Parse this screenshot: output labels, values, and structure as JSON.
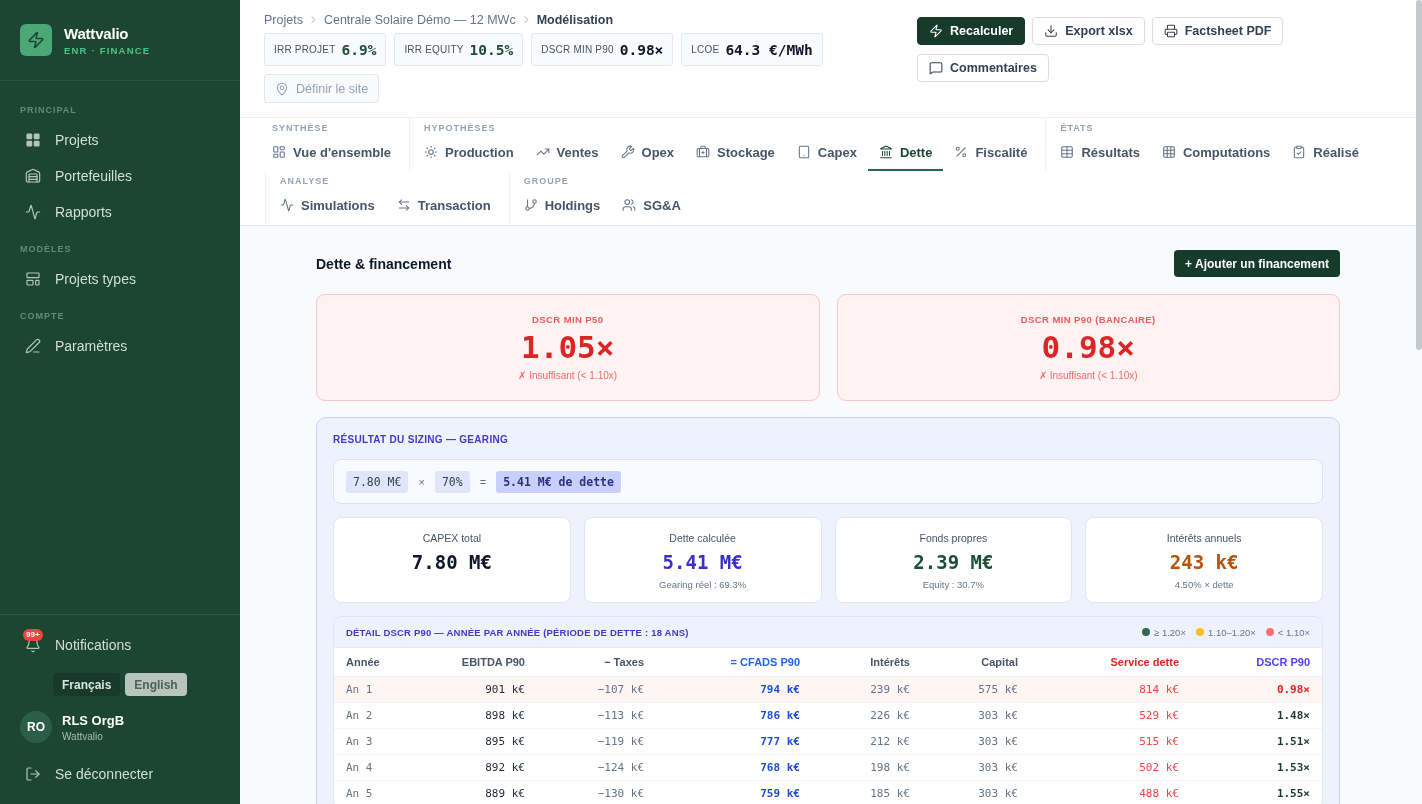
{
  "sidebar": {
    "brand": {
      "name": "Wattvalio",
      "tagline": "ENR · FINANCE"
    },
    "sections": [
      {
        "label": "PRINCIPAL",
        "items": [
          {
            "label": "Projets",
            "selected": false
          },
          {
            "label": "Portefeuilles",
            "selected": false
          },
          {
            "label": "Rapports",
            "selected": false
          }
        ]
      },
      {
        "label": "MODÈLES",
        "items": [
          {
            "label": "Projets types",
            "selected": false
          }
        ]
      },
      {
        "label": "COMPTE",
        "items": [
          {
            "label": "Paramètres",
            "selected": false
          }
        ]
      }
    ],
    "notifications": {
      "label": "Notifications",
      "badge": "99+"
    },
    "languages": [
      {
        "label": "Français",
        "selected": true
      },
      {
        "label": "English",
        "selected": false
      }
    ],
    "user": {
      "initials": "RO",
      "name": "RLS OrgB",
      "organization": "Wattvalio"
    },
    "logout": {
      "label": "Se déconnecter"
    }
  },
  "header": {
    "breadcrumb": [
      {
        "label": "Projets"
      },
      {
        "label": "Centrale Solaire Démo — 12 MWc"
      },
      {
        "label": "Modélisation"
      }
    ],
    "kpis": [
      {
        "label": "IRR PROJET",
        "value": "6.9%",
        "kind": "good"
      },
      {
        "label": "IRR EQUITY",
        "value": "10.5%",
        "kind": "good"
      },
      {
        "label": "DSCR MIN P90",
        "value": "0.98×",
        "kind": "neutral"
      },
      {
        "label": "LCOE",
        "value": "64.3 €/MWh",
        "kind": "neutral"
      }
    ],
    "site_button": {
      "label": "Définir le site",
      "disabled": true
    },
    "actions": [
      {
        "label": "Recalculer",
        "kind": "primary"
      },
      {
        "label": "Export xlsx",
        "kind": "secondary"
      },
      {
        "label": "Factsheet PDF",
        "kind": "secondary"
      },
      {
        "label": "Commentaires",
        "kind": "secondary"
      }
    ]
  },
  "nav": {
    "groups": [
      {
        "label": "SYNTHÈSE",
        "tabs": [
          {
            "label": "Vue d'ensemble",
            "selected": false
          }
        ]
      },
      {
        "label": "HYPOTHÈSES",
        "tabs": [
          {
            "label": "Production",
            "selected": false
          },
          {
            "label": "Ventes",
            "selected": false
          },
          {
            "label": "Opex",
            "selected": false
          },
          {
            "label": "Stockage",
            "selected": false
          },
          {
            "label": "Capex",
            "selected": false
          },
          {
            "label": "Dette",
            "selected": true
          },
          {
            "label": "Fiscalité",
            "selected": false
          }
        ]
      },
      {
        "label": "ÉTATS",
        "tabs": [
          {
            "label": "Résultats",
            "selected": false
          },
          {
            "label": "Computations",
            "selected": false
          },
          {
            "label": "Réalisé",
            "selected": false
          }
        ]
      },
      {
        "label": "ANALYSE",
        "tabs": [
          {
            "label": "Simulations",
            "selected": false
          },
          {
            "label": "Transaction",
            "selected": false
          }
        ]
      },
      {
        "label": "GROUPE",
        "tabs": [
          {
            "label": "Holdings",
            "selected": false
          },
          {
            "label": "SG&A",
            "selected": false
          }
        ]
      }
    ]
  },
  "content": {
    "title": "Dette & financement",
    "add_button": "+ Ajouter un financement",
    "dscr_cards": [
      {
        "label": "DSCR MIN P50",
        "value": "1.05×",
        "note": "✗ Insuffisant (< 1.10x)",
        "kind": "insufficient"
      },
      {
        "label": "DSCR MIN P90 (BANCAIRE)",
        "value": "0.98×",
        "note": "✗ Insuffisant (< 1.10x)",
        "kind": "insufficient"
      }
    ],
    "sizing": {
      "title": "RÉSULTAT DU SIZING — GEARING",
      "formula": [
        {
          "kind": "term",
          "text": "7.80 M€"
        },
        {
          "kind": "operator",
          "text": "×"
        },
        {
          "kind": "term",
          "text": "70%"
        },
        {
          "kind": "operator",
          "text": "="
        },
        {
          "kind": "result",
          "text": "5.41 M€ de dette"
        }
      ],
      "stats": [
        {
          "label": "CAPEX total",
          "value": "7.80 M€",
          "kind": "neutral"
        },
        {
          "label": "Dette calculée",
          "value": "5.41 M€",
          "note": "Gearing réel : 69.3%",
          "kind": "debt"
        },
        {
          "label": "Fonds propres",
          "value": "2.39 M€",
          "note": "Equity : 30.7%",
          "kind": "equity"
        },
        {
          "label": "Intérêts annuels",
          "value": "243 k€",
          "note": "4.50% × dette",
          "kind": "interest"
        }
      ]
    },
    "dscr_table": {
      "title": "DÉTAIL DSCR P90 — ANNÉE PAR ANNÉE (PÉRIODE DE DETTE : 18 ANS)",
      "legend": [
        {
          "label": "≥ 1.20×",
          "color": "#2f6b4f"
        },
        {
          "label": "1.10–1.20×",
          "color": "#fbbf24"
        },
        {
          "label": "< 1.10×",
          "color": "#f87171"
        }
      ],
      "columns": [
        {
          "label": "Année",
          "kind": "year"
        },
        {
          "label": "EBITDA P90",
          "kind": "amount"
        },
        {
          "label": "− Taxes",
          "kind": "muted"
        },
        {
          "label": "= CFADS P90",
          "kind": "cfads"
        },
        {
          "label": "Intérêts",
          "kind": "muted"
        },
        {
          "label": "Capital",
          "kind": "muted"
        },
        {
          "label": "Service dette",
          "kind": "service"
        },
        {
          "label": "DSCR P90",
          "kind": "dscr"
        }
      ],
      "rows": [
        {
          "cells": [
            "An 1",
            "901 k€",
            "−107 k€",
            "794 k€",
            "239 k€",
            "575 k€",
            "814 k€",
            "0.98×"
          ],
          "kind": "insufficient"
        },
        {
          "cells": [
            "An 2",
            "898 k€",
            "−113 k€",
            "786 k€",
            "226 k€",
            "303 k€",
            "529 k€",
            "1.48×"
          ],
          "kind": "ok"
        },
        {
          "cells": [
            "An 3",
            "895 k€",
            "−119 k€",
            "777 k€",
            "212 k€",
            "303 k€",
            "515 k€",
            "1.51×"
          ],
          "kind": "ok"
        },
        {
          "cells": [
            "An 4",
            "892 k€",
            "−124 k€",
            "768 k€",
            "198 k€",
            "303 k€",
            "502 k€",
            "1.53×"
          ],
          "kind": "ok"
        },
        {
          "cells": [
            "An 5",
            "889 k€",
            "−130 k€",
            "759 k€",
            "185 k€",
            "303 k€",
            "488 k€",
            "1.55×"
          ],
          "kind": "ok"
        }
      ]
    }
  }
}
